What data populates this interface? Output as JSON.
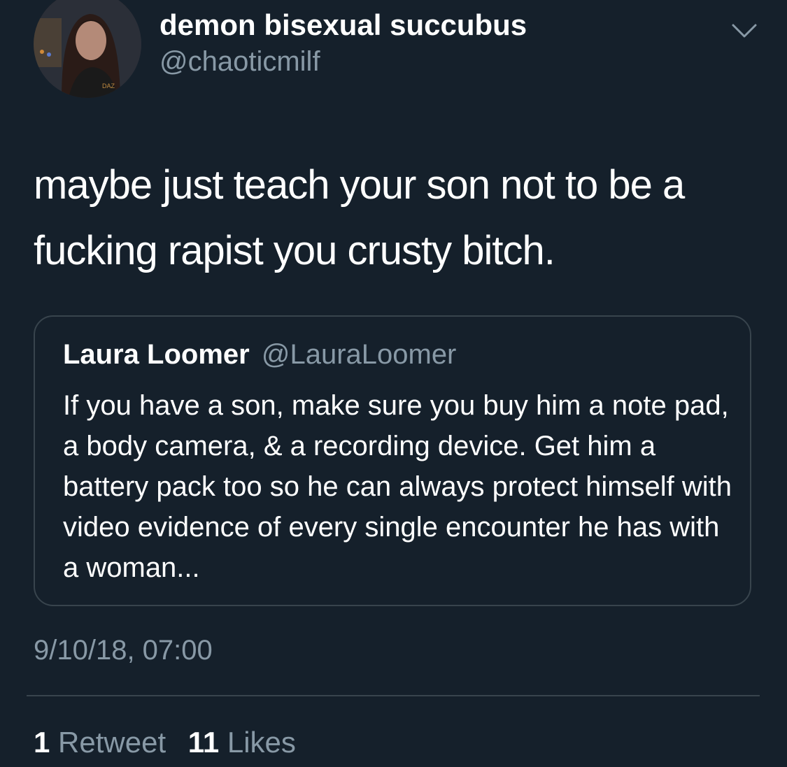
{
  "author": {
    "display_name": "demon bisexual succubus",
    "handle": "@chaoticmilf",
    "avatar_icon": "profile-photo"
  },
  "tweet": {
    "text": "maybe just teach your son not to be a fucking rapist you crusty bitch."
  },
  "quoted_tweet": {
    "name": "Laura Loomer",
    "handle": "@LauraLoomer",
    "text": "If you have a son, make sure you buy him a note pad, a body camera, & a recording device. Get him a battery pack too so he can always protect himself with video evidence of every single encounter he has with a woman..."
  },
  "meta": {
    "timestamp": "9/10/18, 07:00"
  },
  "stats": {
    "retweet_count": "1",
    "retweet_label": "Retweet",
    "like_count": "11",
    "like_label": "Likes"
  },
  "colors": {
    "background": "#15202b",
    "primary_text": "#ffffff",
    "secondary_text": "#8899a6",
    "border": "#38444d"
  },
  "icons": {
    "menu": "chevron-down-icon"
  }
}
